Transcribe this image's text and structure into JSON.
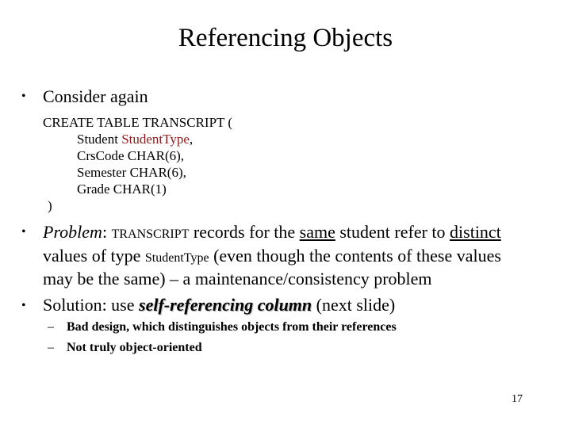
{
  "slide": {
    "title": "Referencing Objects",
    "page_number": "17",
    "accent_color": "#8B1A1A"
  },
  "bullets": [
    {
      "text": "Consider again"
    },
    {
      "code": {
        "line0": "CREATE  TABLE  TRANSCRIPT  (",
        "line1_a": "Student  ",
        "line1_b": "StudentType",
        "line1_c": ",",
        "line2": "CrsCode CHAR(6),",
        "line3": "Semester CHAR(6),",
        "line4": "Grade  CHAR(1)",
        "line5": ")"
      }
    },
    {
      "problem_label": "Problem",
      "colon": ": ",
      "transcript": "TRANSCRIPT",
      "t1": " records for the ",
      "same": "same",
      "t2": " student refer to ",
      "distinct": "distinct",
      "line2_a": "values of type ",
      "studenttype": "StudentType",
      "line2_b": " (even though the contents of these values",
      "line3": "may be the same) – a maintenance/consistency problem"
    },
    {
      "a": "Solution: use ",
      "em": "self-referencing column",
      "b": "  (next slide)"
    }
  ],
  "sub_bullets": [
    "Bad design, which distinguishes objects from their references",
    "Not truly object-oriented"
  ],
  "bullet_char": "•",
  "dash_char": "–"
}
